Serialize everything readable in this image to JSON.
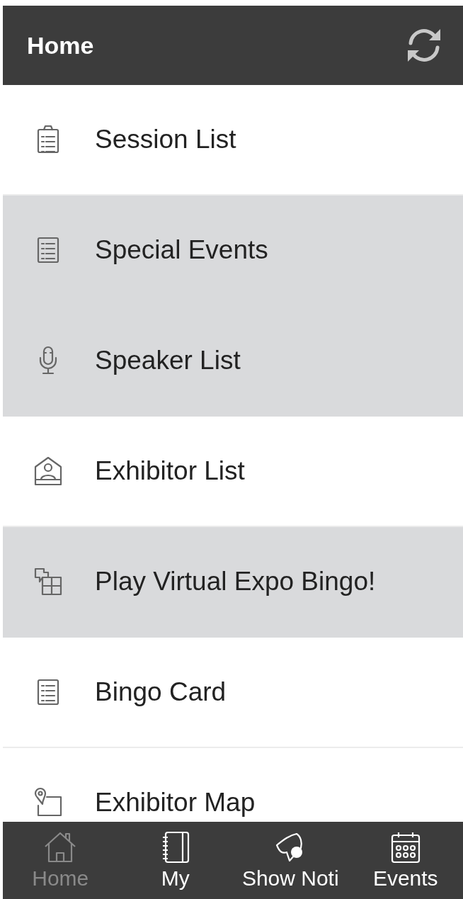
{
  "header": {
    "title": "Home"
  },
  "menu": [
    {
      "label": "Session List",
      "kind": "clipboard",
      "highlighted": false
    },
    {
      "label": "Special Events",
      "kind": "document",
      "highlighted": true
    },
    {
      "label": "Speaker List",
      "kind": "microphone",
      "highlighted": true
    },
    {
      "label": "Exhibitor List",
      "kind": "booth",
      "highlighted": false
    },
    {
      "label": "Play Virtual Expo Bingo!",
      "kind": "puzzle",
      "highlighted": true
    },
    {
      "label": "Bingo Card",
      "kind": "document",
      "highlighted": false
    },
    {
      "label": "Exhibitor Map",
      "kind": "map",
      "highlighted": false
    }
  ],
  "tab_bar": [
    {
      "label": "Home",
      "kind": "home",
      "selected": true
    },
    {
      "label": "My",
      "kind": "notebook",
      "selected": false
    },
    {
      "label": "Show Noti",
      "kind": "bell",
      "selected": false
    },
    {
      "label": "Events",
      "kind": "calendar",
      "selected": false
    }
  ]
}
